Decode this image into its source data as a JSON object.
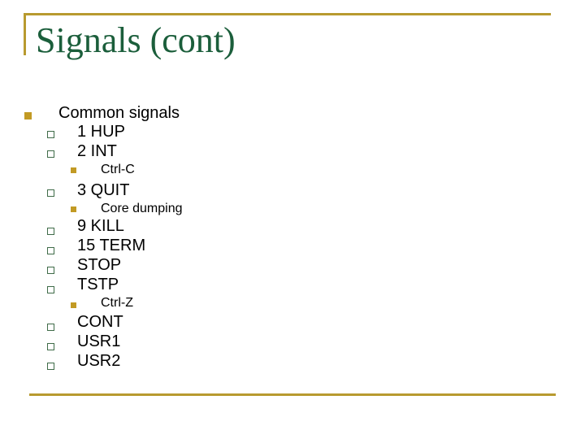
{
  "slide": {
    "title": "Signals (cont)",
    "colors": {
      "title": "#1b5e3b",
      "rule": "#b89a2f",
      "square_bullet": "#c29a24",
      "hollow_bullet_border": "#3f6b48"
    },
    "outline": [
      {
        "level": 1,
        "bullet": "filled-square",
        "text": "Common signals"
      },
      {
        "level": 2,
        "bullet": "hollow-square",
        "text": "1 HUP"
      },
      {
        "level": 2,
        "bullet": "hollow-square",
        "text": "2 INT"
      },
      {
        "level": 3,
        "bullet": "filled-square",
        "text": "Ctrl-C"
      },
      {
        "level": 2,
        "bullet": "hollow-square",
        "text": "3 QUIT"
      },
      {
        "level": 3,
        "bullet": "filled-square",
        "text": "Core dumping"
      },
      {
        "level": 2,
        "bullet": "hollow-square",
        "text": "9 KILL"
      },
      {
        "level": 2,
        "bullet": "hollow-square",
        "text": "15 TERM"
      },
      {
        "level": 2,
        "bullet": "hollow-square",
        "text": "STOP"
      },
      {
        "level": 2,
        "bullet": "hollow-square",
        "text": "TSTP"
      },
      {
        "level": 3,
        "bullet": "filled-square",
        "text": "Ctrl-Z"
      },
      {
        "level": 2,
        "bullet": "hollow-square",
        "text": "CONT"
      },
      {
        "level": 2,
        "bullet": "hollow-square",
        "text": "USR1"
      },
      {
        "level": 2,
        "bullet": "hollow-square",
        "text": "USR2"
      }
    ]
  }
}
